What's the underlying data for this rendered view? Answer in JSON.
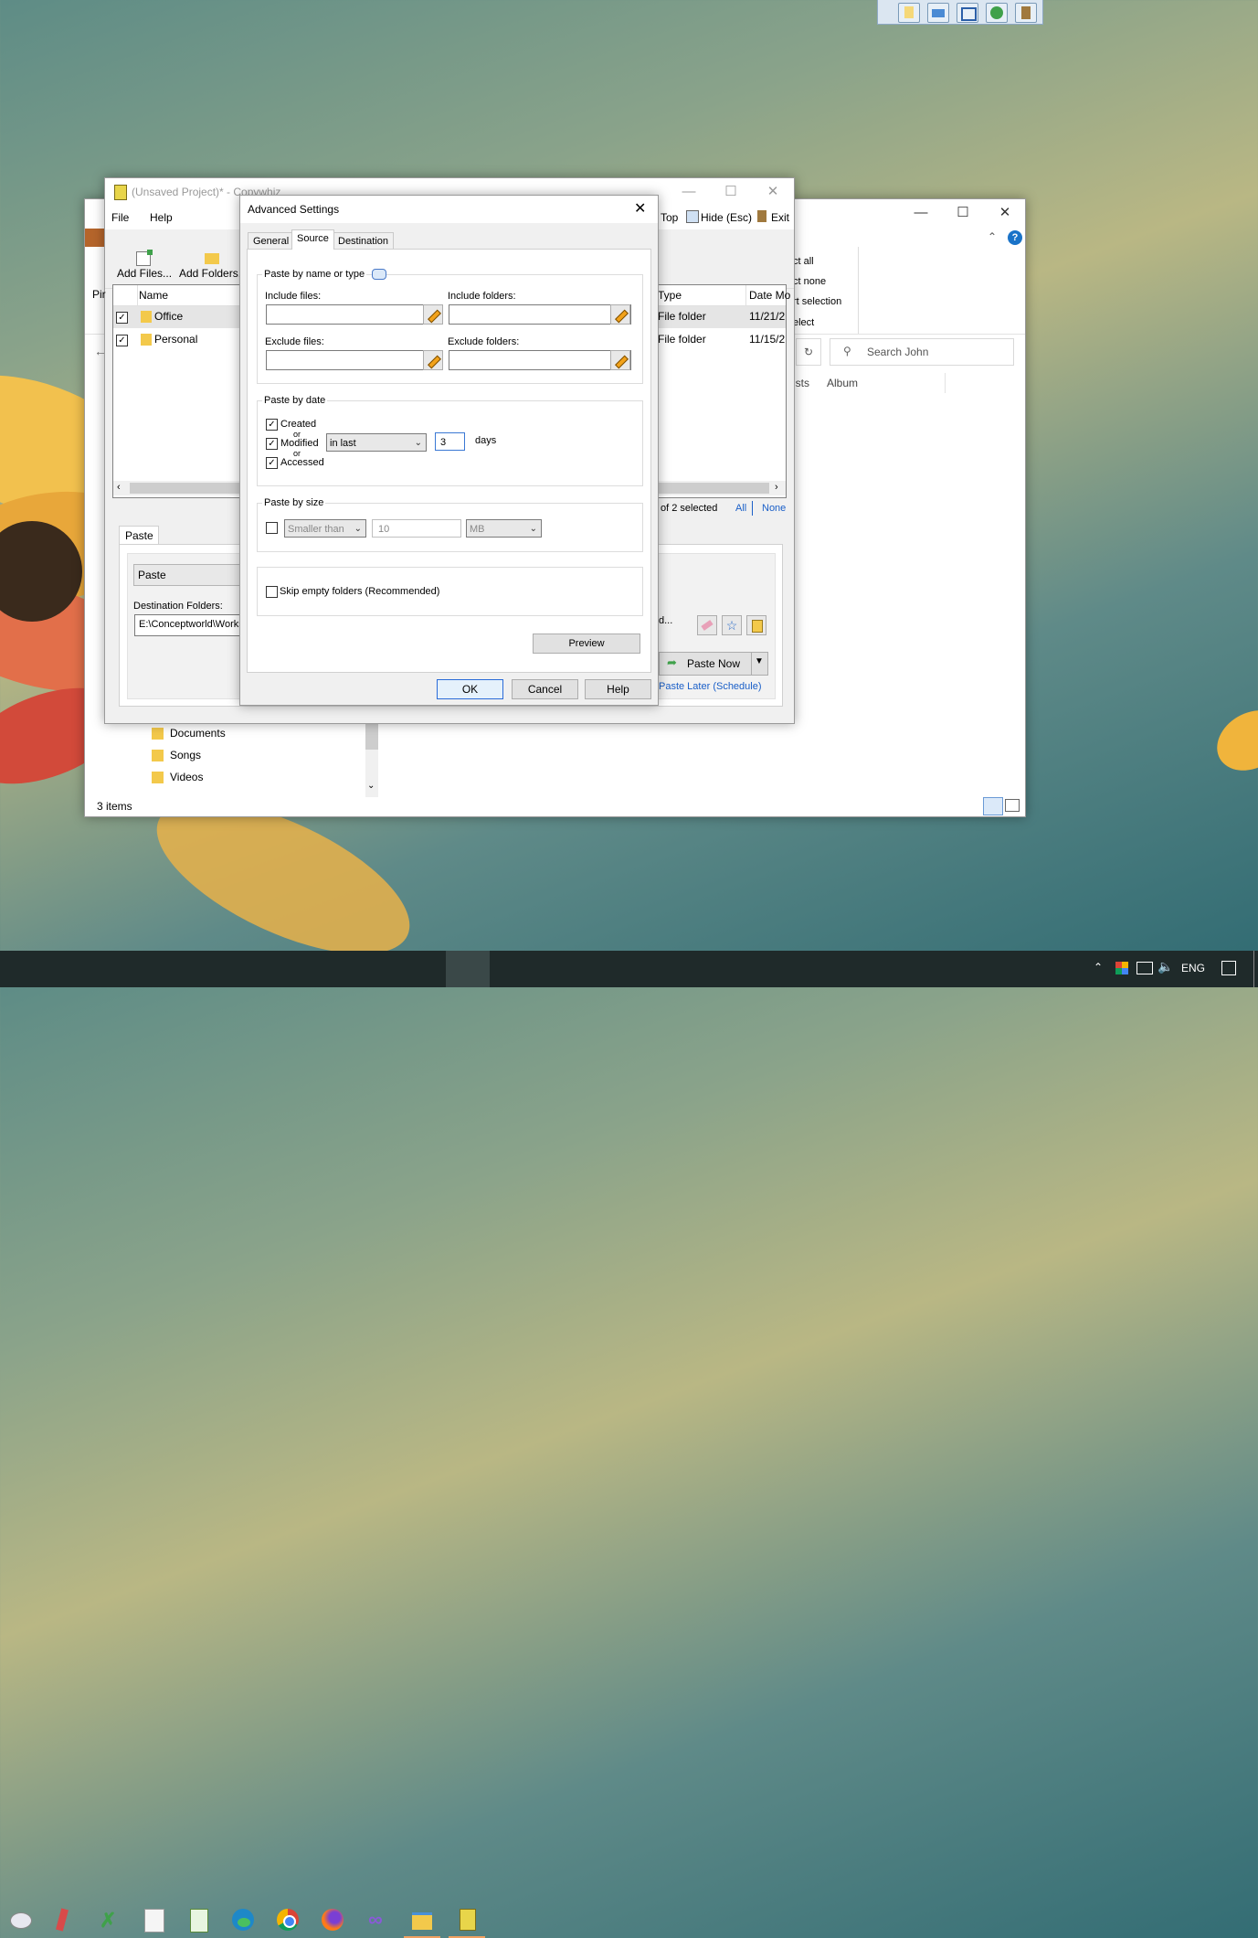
{
  "top_toolbar": {
    "icons": [
      "new-file-icon",
      "open-folder-icon",
      "windows-icon",
      "globe-icon",
      "clipboard-icon"
    ]
  },
  "explorer": {
    "search_placeholder": "Search John",
    "ribbon_items": [
      "ct all",
      "ct none",
      "rt selection",
      "elect"
    ],
    "columns": [
      "ists",
      "Album"
    ],
    "folders": [
      "Documents",
      "Songs",
      "Videos"
    ],
    "status": "3 items"
  },
  "copywhiz": {
    "title": "(Unsaved Project)* - Copywhiz",
    "menu": [
      "File",
      "Help"
    ],
    "toolbar_right": [
      "Top",
      "Hide (Esc)",
      "Exit"
    ],
    "add_files": "Add Files...",
    "add_folders": "Add Folders...",
    "pin_label": "Pir",
    "columns": [
      "Name",
      "Type",
      "Date Mo"
    ],
    "rows": [
      {
        "name": "Office",
        "type": "File folder",
        "date": "11/21/2"
      },
      {
        "name": "Personal",
        "type": "File folder",
        "date": "11/15/2"
      }
    ],
    "selection_status": "of 2 selected",
    "select_all": "All",
    "select_none": "None",
    "paste_tab": "Paste",
    "paste_mode": "Paste",
    "destination_label": "Destination Folders:",
    "destination_value": "E:\\Conceptworld\\Works",
    "browse_label": "d...",
    "paste_now": "Paste Now",
    "paste_later": "Paste Later (Schedule)"
  },
  "dialog": {
    "title": "Advanced Settings",
    "tabs": [
      "General",
      "Source",
      "Destination"
    ],
    "by_name_label": "Paste by name or type",
    "include_files_label": "Include files:",
    "include_folders_label": "Include folders:",
    "exclude_files_label": "Exclude files:",
    "exclude_folders_label": "Exclude folders:",
    "by_date_label": "Paste by date",
    "created_label": "Created",
    "or1": "or",
    "modified_label": "Modified",
    "or2": "or",
    "accessed_label": "Accessed",
    "date_mode": "in last",
    "days_value": "3",
    "days_label": "days",
    "by_size_label": "Paste by size",
    "size_mode": "Smaller than",
    "size_value": "10",
    "size_unit": "MB",
    "skip_empty_label": "Skip empty folders (Recommended)",
    "preview_label": "Preview",
    "ok_label": "OK",
    "cancel_label": "Cancel",
    "help_label": "Help"
  },
  "taskbar": {
    "language": "ENG",
    "apps": [
      "paint-icon",
      "ruler-icon",
      "excel-x-icon",
      "dictionary-icon",
      "notepad-chart-icon",
      "edge-icon",
      "chrome-icon",
      "firefox-icon",
      "visual-studio-icon",
      "file-explorer-icon",
      "copywhiz-icon"
    ]
  }
}
